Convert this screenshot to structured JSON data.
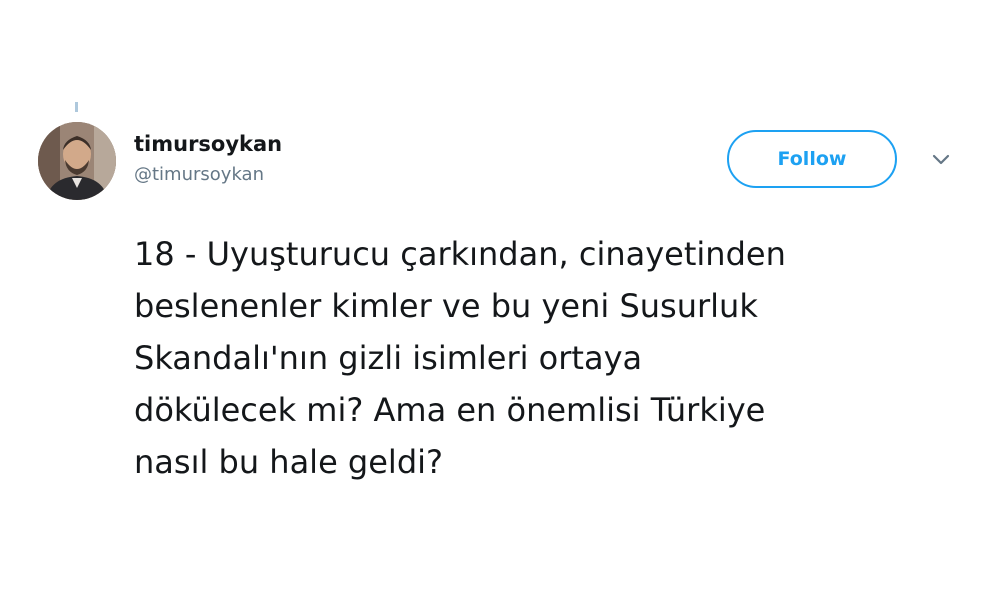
{
  "user": {
    "display_name": "timursoykan",
    "handle": "@timursoykan"
  },
  "follow_button": {
    "label": "Follow"
  },
  "tweet": {
    "lines": [
      "18 - Uyuşturucu çarkından, cinayetinden",
      "beslenenler kimler ve bu yeni Susurluk",
      "Skandalı'nın gizli isimleri ortaya",
      "dökülecek mi? Ama en önemlisi Türkiye",
      "nasıl bu hale geldi?"
    ]
  },
  "icons": {
    "avatar": "profile-photo",
    "menu": "chevron-down-icon"
  },
  "colors": {
    "accent": "#1da1f2",
    "text": "#14171a",
    "secondary": "#657786"
  }
}
